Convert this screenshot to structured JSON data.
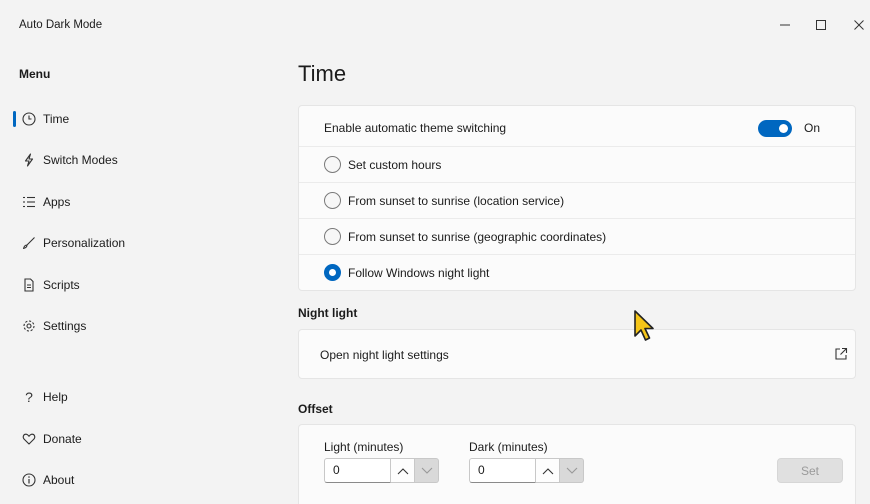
{
  "window": {
    "title": "Auto Dark Mode",
    "controls": {
      "minimize": "—",
      "maximize": "☐",
      "close": "✕"
    }
  },
  "sidebar": {
    "menu_title": "Menu",
    "items": [
      {
        "label": "Time",
        "icon": "clock-icon",
        "active": true
      },
      {
        "label": "Switch Modes",
        "icon": "lightning-icon"
      },
      {
        "label": "Apps",
        "icon": "list-icon"
      },
      {
        "label": "Personalization",
        "icon": "brush-icon"
      },
      {
        "label": "Scripts",
        "icon": "document-icon"
      },
      {
        "label": "Settings",
        "icon": "gear-icon"
      }
    ],
    "bottom_items": [
      {
        "label": "Help",
        "icon": "question-icon"
      },
      {
        "label": "Donate",
        "icon": "heart-icon"
      },
      {
        "label": "About",
        "icon": "info-icon"
      }
    ]
  },
  "main": {
    "page_title": "Time",
    "switching_card": {
      "enable_label": "Enable automatic theme switching",
      "toggle_state": "On",
      "options": [
        {
          "label": "Set custom hours",
          "checked": false
        },
        {
          "label": "From sunset to sunrise (location service)",
          "checked": false
        },
        {
          "label": "From sunset to sunrise (geographic coordinates)",
          "checked": false
        },
        {
          "label": "Follow Windows night light",
          "checked": true
        }
      ]
    },
    "night_light": {
      "section_title": "Night light",
      "open_settings_label": "Open night light settings"
    },
    "offset": {
      "section_title": "Offset",
      "light_label": "Light (minutes)",
      "light_value": "0",
      "dark_label": "Dark (minutes)",
      "dark_value": "0",
      "set_button": "Set"
    }
  },
  "colors": {
    "accent": "#0067c0",
    "cursor": "#f5c518"
  }
}
